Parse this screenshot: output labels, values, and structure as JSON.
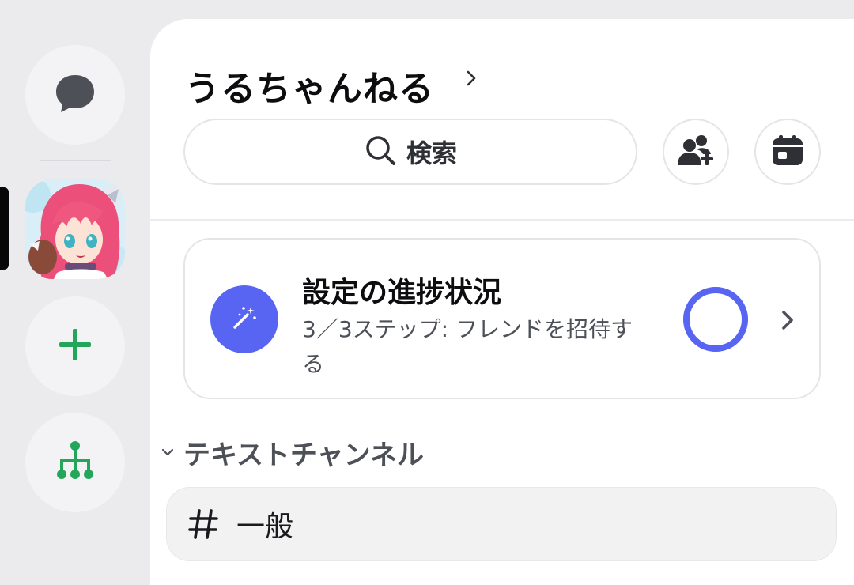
{
  "server": {
    "name": "うるちゃんねる"
  },
  "search": {
    "label": "検索"
  },
  "setup_progress": {
    "title": "設定の進捗状況",
    "subtitle": "3／3ステップ: フレンドを招待する",
    "progress": 1.0
  },
  "channels": {
    "category_label": "テキストチャンネル",
    "items": [
      {
        "name": "一般"
      }
    ]
  },
  "icons": {
    "rail_dm": "chat-bubble-icon",
    "rail_add": "plus-icon",
    "rail_discover": "hub-tree-icon",
    "search": "search-icon",
    "invite": "add-member-icon",
    "events": "calendar-icon",
    "setup": "magic-wand-icon",
    "channel": "hash-icon"
  },
  "colors": {
    "accent": "#5865f2",
    "green": "#23a55a",
    "rail_bg": "#ebebed",
    "panel_bg": "#ffffff"
  }
}
